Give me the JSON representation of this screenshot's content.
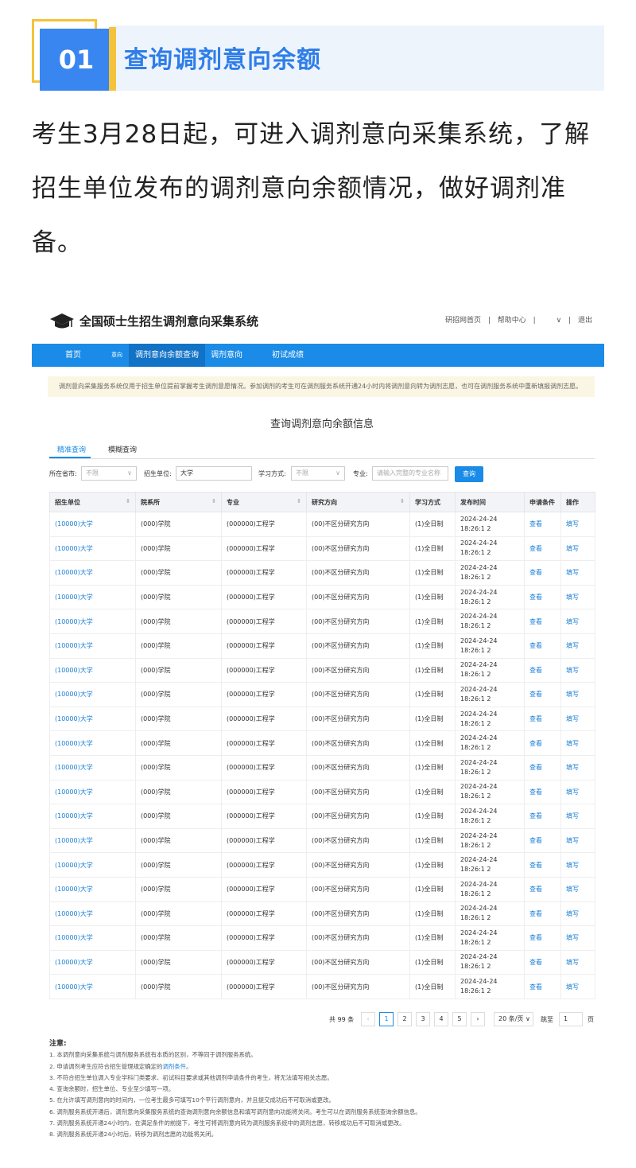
{
  "header": {
    "number": "01",
    "title": "查询调剂意向余额"
  },
  "intro": {
    "line1": "考生3月28日起，可进入调剂意向采集系统，了解",
    "line2": "招生单位发布的调剂意向余额情况，做好调剂准",
    "line3": "备。"
  },
  "system": {
    "title": "全国硕士生招生调剂意向采集系统",
    "top_links": [
      "研招网首页",
      "|",
      "帮助中心",
      "|",
      "∨",
      "|",
      "退出"
    ],
    "nav": [
      "首页",
      "意向",
      "调剂意向余额查询",
      "调剂意向",
      "初试成绩"
    ],
    "notice": "调剂意向采集服务系统仅用于招生单位提前掌握考生调剂意愿情况。参加调剂的考生可在调剂服务系统开通24小时内将调剂意向转为调剂志愿，也可在调剂服务系统中重新填报调剂志愿。",
    "query_title": "查询调剂意向余额信息",
    "tabs": [
      "精准查询",
      "模糊查询"
    ],
    "filter": {
      "province_label": "所在省市:",
      "province_value": "不限",
      "unit_label": "招生单位:",
      "unit_value": "大学",
      "mode_label": "学习方式:",
      "mode_value": "不限",
      "major_label": "专业:",
      "major_placeholder": "请输入完整的专业名称",
      "search_button": "查询"
    },
    "table": {
      "headers": [
        "招生单位",
        "院系所",
        "专业",
        "研究方向",
        "学习方式",
        "发布时间",
        "申请条件",
        "操作"
      ],
      "row": {
        "unit": "(10000)大学",
        "dept": "(000)学院",
        "major": "(000000)工程学",
        "direction": "(00)不区分研究方向",
        "mode": "(1)全日制",
        "time": "2024-24-24 18:26:1 2",
        "condition": "查看",
        "action": "填写"
      },
      "row_count": 20
    },
    "pagination": {
      "total": "共 99 条",
      "prev": "‹",
      "pages": [
        "1",
        "2",
        "3",
        "4",
        "5"
      ],
      "next": "›",
      "page_size": "20 条/页 ∨",
      "jump_label": "跳至",
      "jump_value": "1",
      "page_label": "页"
    },
    "notes": {
      "title": "注意:",
      "items": [
        "1. 本调剂意向采集系统与调剂服务系统有本质的区别，不等同于调剂服务系统。",
        "2. 申请调剂考生应符合招生管理规定确定的",
        "3. 不符合招生单位调入专业学科门类要求、初试科目要求或其他调剂申请条件的考生，将无法填写相关志愿。",
        "4. 查询余额时，招生单位、专业至少填写一项。",
        "5. 在允许填写调剂意向的时间内，一位考生最多可填写10个平行调剂意向，并且提交成功后不可取消或更改。",
        "6. 调剂服务系统开通后，调剂意向采集服务系统的查询调剂意向余额信息和填写调剂意向功能将关闭。考生可以在调剂服务系统查询余额信息。",
        "7. 调剂服务系统开通24小时内，在满足条件的前提下，考生可将调剂意向转为调剂服务系统中的调剂志愿，转移成功后不可取消或更改。",
        "8. 调剂服务系统开通24小时后，转移为调剂志愿的功能将关闭。"
      ],
      "item2_link": "调剂条件",
      "item2_end": "。"
    }
  }
}
